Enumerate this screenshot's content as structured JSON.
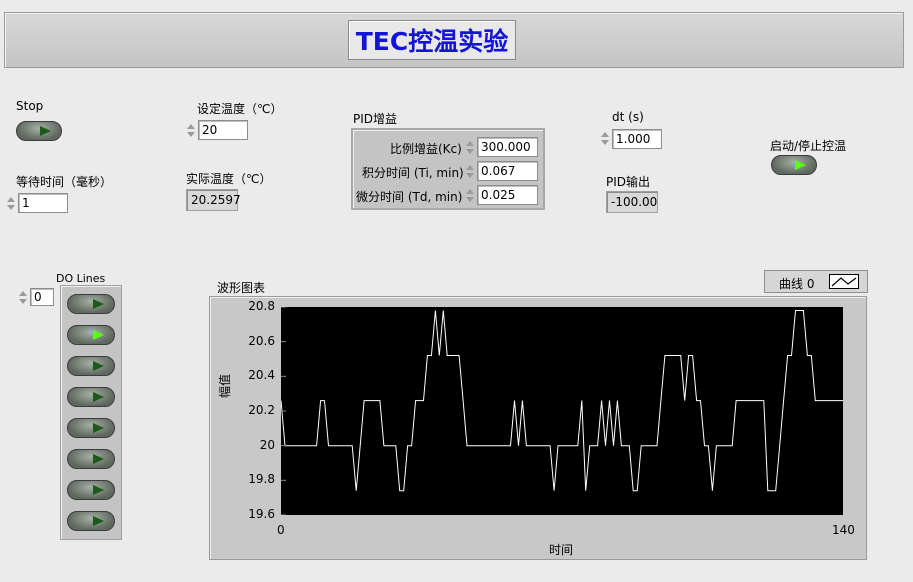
{
  "title": "TEC控温实验",
  "stop": {
    "label": "Stop"
  },
  "wait": {
    "label": "等待时间（毫秒）",
    "value": "1"
  },
  "set_temp": {
    "label": "设定温度（℃）",
    "value": "20"
  },
  "actual_temp": {
    "label": "实际温度（℃）",
    "value": "20.2597"
  },
  "pid_gains": {
    "label": "PID增益",
    "kc_label": "比例增益(Kc)",
    "kc_value": "300.000",
    "ti_label": "积分时间 (Ti, min)",
    "ti_value": "0.067",
    "td_label": "微分时间 (Td, min)",
    "td_value": "0.025"
  },
  "dt": {
    "label": "dt (s)",
    "value": "1.000"
  },
  "pid_output": {
    "label": "PID输出",
    "value": "-100.00"
  },
  "start_stop": {
    "label": "启动/停止控温"
  },
  "do_lines": {
    "label": "DO Lines",
    "index": "0",
    "states": [
      false,
      true,
      false,
      false,
      false,
      false,
      false,
      false
    ]
  },
  "graph": {
    "label": "波形图表",
    "legend": "曲线 0"
  },
  "chart_data": {
    "type": "line",
    "xlabel": "时间",
    "ylabel": "幅值",
    "xlim": [
      0,
      140
    ],
    "ylim": [
      19.6,
      20.8
    ],
    "x_ticks": [
      "0",
      "140"
    ],
    "y_ticks": [
      "20.8",
      "20.6",
      "20.4",
      "20.2",
      "20",
      "19.8",
      "19.6"
    ],
    "series": [
      {
        "name": "曲线 0",
        "color": "#ffffff",
        "values": [
          20.26,
          20.0,
          20.0,
          20.0,
          20.0,
          20.0,
          20.0,
          20.0,
          20.0,
          20.0,
          20.26,
          20.26,
          20.0,
          20.0,
          20.0,
          20.0,
          20.0,
          20.0,
          20.0,
          19.74,
          20.0,
          20.26,
          20.26,
          20.26,
          20.26,
          20.26,
          20.0,
          20.0,
          20.0,
          20.0,
          19.74,
          19.74,
          20.0,
          20.0,
          20.26,
          20.26,
          20.26,
          20.52,
          20.52,
          20.78,
          20.52,
          20.78,
          20.52,
          20.52,
          20.52,
          20.52,
          20.26,
          20.0,
          20.0,
          20.0,
          20.0,
          20.0,
          20.0,
          20.0,
          20.0,
          20.0,
          20.0,
          20.0,
          20.0,
          20.26,
          20.0,
          20.26,
          20.0,
          20.0,
          20.0,
          20.0,
          20.0,
          20.0,
          20.0,
          19.74,
          20.0,
          20.0,
          20.0,
          20.0,
          20.0,
          20.0,
          20.26,
          19.74,
          20.0,
          20.0,
          20.0,
          20.26,
          20.0,
          20.26,
          20.0,
          20.26,
          20.0,
          20.0,
          20.0,
          19.74,
          19.74,
          20.0,
          20.0,
          20.0,
          20.0,
          20.0,
          20.26,
          20.52,
          20.52,
          20.52,
          20.52,
          20.52,
          20.26,
          20.52,
          20.52,
          20.26,
          20.26,
          20.0,
          20.0,
          19.74,
          20.0,
          20.0,
          20.0,
          20.0,
          20.0,
          20.26,
          20.26,
          20.26,
          20.26,
          20.26,
          20.26,
          20.26,
          20.26,
          19.74,
          19.74,
          19.74,
          20.0,
          20.26,
          20.52,
          20.52,
          20.78,
          20.78,
          20.78,
          20.52,
          20.52,
          20.26,
          20.26,
          20.26,
          20.26,
          20.26,
          20.26,
          20.26,
          20.26
        ]
      }
    ]
  }
}
